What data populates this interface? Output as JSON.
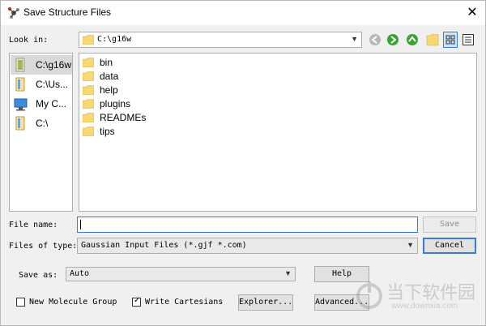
{
  "window": {
    "title": "Save Structure Files",
    "close_symbol": "✕"
  },
  "look_in": {
    "label": "Look in:",
    "value": "C:\\g16w"
  },
  "sidebar": {
    "items": [
      {
        "label": "C:\\g16w"
      },
      {
        "label": "C:\\Us..."
      },
      {
        "label": "My C..."
      },
      {
        "label": "C:\\"
      }
    ]
  },
  "files": [
    {
      "name": "bin"
    },
    {
      "name": "data"
    },
    {
      "name": "help"
    },
    {
      "name": "plugins"
    },
    {
      "name": "READMEs"
    },
    {
      "name": "tips"
    }
  ],
  "file_name": {
    "label": "File name:",
    "value": ""
  },
  "files_of_type": {
    "label": "Files of type:",
    "value": "Gaussian Input Files (*.gjf *.com)"
  },
  "buttons": {
    "save": "Save",
    "cancel": "Cancel",
    "help": "Help",
    "explorer": "Explorer...",
    "advanced": "Advanced..."
  },
  "save_as": {
    "label": "Save as:",
    "value": "Auto"
  },
  "options": {
    "new_molecule_group": "New Molecule Group",
    "new_molecule_group_checked": false,
    "write_cartesians": "Write Cartesians",
    "write_cartesians_checked": true
  },
  "watermark": {
    "text_cn": "当下软件园",
    "text_url": "www.downxia.com"
  },
  "colors": {
    "folder": "#f8d775",
    "accent": "#3a7bd5",
    "nav_green": "#3aa335"
  }
}
